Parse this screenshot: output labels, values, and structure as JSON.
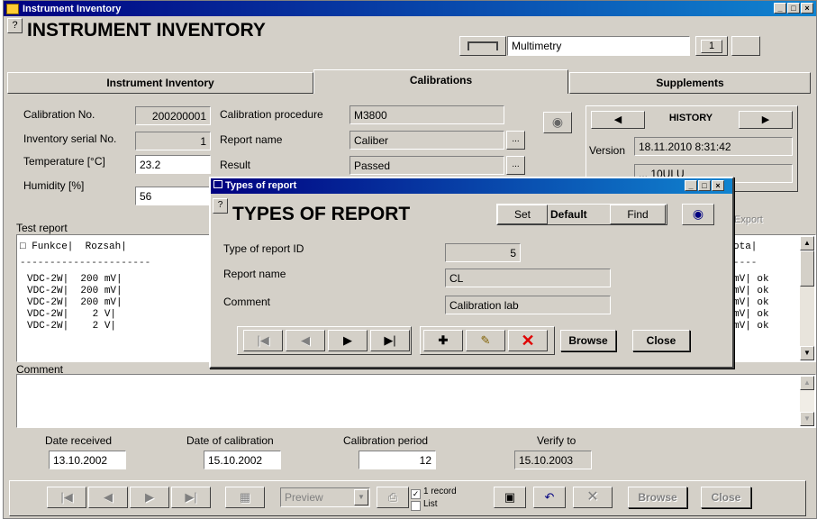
{
  "window": {
    "title": "Instrument Inventory"
  },
  "header": {
    "help": "?",
    "title": "INSTRUMENT INVENTORY",
    "category": "Multimetry",
    "counter": "1"
  },
  "tabs": [
    "Instrument Inventory",
    "Calibrations",
    "Supplements"
  ],
  "form": {
    "cal_no_label": "Calibration No.",
    "cal_no": "200200001",
    "serial_label": "Inventory serial No.",
    "serial": "1",
    "temp_label": "Temperature [°C]",
    "temp": "23.2",
    "hum_label": "Humidity [%]",
    "hum": "56",
    "proc_label": "Calibration procedure",
    "proc": "M3800",
    "report_label": "Report name",
    "report": "Caliber",
    "result_label": "Result",
    "result": "Passed",
    "ellipsis": "..."
  },
  "history": {
    "label": "HISTORY",
    "version_label": "Version",
    "version": "18.11.2010 8:31:42",
    "field2": "... 10ULU"
  },
  "export_label": "Export",
  "test_report": {
    "label": "Test report",
    "header_left": "□ Funkce|  Rozsah|",
    "header_right": "ota|",
    "dashes_left": "----------------------",
    "dashes_right": "----",
    "rows_left": [
      "VDC-2W|  200 mV|",
      "VDC-2W|  200 mV|",
      "VDC-2W|  200 mV|",
      "VDC-2W|    2 V|",
      "VDC-2W|    2 V|"
    ],
    "rows_right": [
      "mV| ok",
      "mV| ok",
      "mV| ok",
      "mV| ok",
      "mV| ok"
    ]
  },
  "comment_label": "Comment",
  "dates": {
    "received_label": "Date received",
    "received": "13.10.2002",
    "calib_label": "Date of calibration",
    "calib": "15.10.2002",
    "period_label": "Calibration period",
    "period": "12",
    "verify_label": "Verify to",
    "verify": "15.10.2003"
  },
  "toolbar": {
    "preview": "Preview",
    "record_1": "1 record",
    "record_2": "List",
    "browse": "Browse",
    "close": "Close"
  },
  "dialog": {
    "title": "Types of report",
    "heading": "TYPES OF REPORT",
    "set": "Set",
    "default": "Default",
    "find": "Find",
    "id_label": "Type of report ID",
    "id": "5",
    "name_label": "Report name",
    "name": "CL",
    "comment_label": "Comment",
    "comment": "Calibration lab",
    "browse": "Browse",
    "close": "Close"
  }
}
